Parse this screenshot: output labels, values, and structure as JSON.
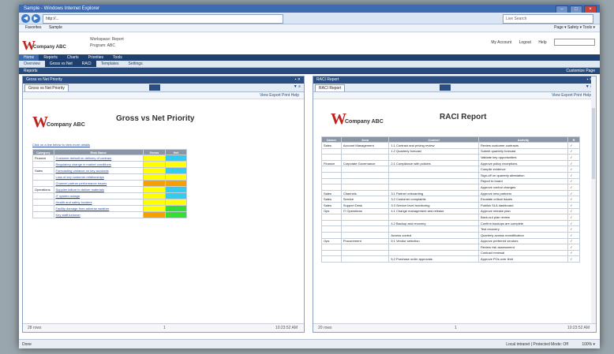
{
  "window": {
    "title": "Sample - Windows Internet Explorer",
    "controls": [
      "–",
      "□",
      "×"
    ]
  },
  "address": {
    "url": "http://...",
    "search_placeholder": "Live Search"
  },
  "ie_menu": {
    "left": [
      "Favorites",
      "Sample"
    ],
    "right": "Page ▾  Safety ▾  Tools ▾"
  },
  "app": {
    "company_letter": "W",
    "company_name": "Company ABC",
    "header_fields": [
      "Workspace:  Report",
      "Program:  ABC"
    ],
    "header_links": [
      "My Account",
      "Logout",
      "Help"
    ],
    "nav": [
      "Home",
      "Reports",
      "Charts",
      "Priorities",
      "Tools"
    ],
    "subnav": [
      "Overview",
      "Gross vs Net",
      "RACI",
      "Templates",
      "Settings"
    ],
    "toolbar": {
      "left": "Reports",
      "right": "Customize Page"
    }
  },
  "left_panel": {
    "header": "Gross vs Net Priority",
    "tab": "Gross vs Net Priority",
    "toolbar_links": "View  Export  Print  Help",
    "report_title": "Gross vs Net Priority",
    "note": "Click on a line below to view more details",
    "columns": [
      "Category",
      "Risk Name",
      "Gross",
      "Net"
    ],
    "rows": [
      {
        "cat": "Finance",
        "name": "Customer default on delivery of contract",
        "gross": "",
        "net": "",
        "gc": "#ffff00",
        "nc": "#33ccee"
      },
      {
        "cat": "",
        "name": "Regulatory change in market conditions",
        "gross": "",
        "net": "",
        "gc": "#ffff00",
        "nc": "#ffff00"
      },
      {
        "cat": "Sales",
        "name": "Forecasting variance on key accounts",
        "gross": "",
        "net": "",
        "gc": "#ffff00",
        "nc": "#33ccee"
      },
      {
        "cat": "",
        "name": "Loss of key customer relationships",
        "gross": "",
        "net": "",
        "gc": "#ffff00",
        "nc": "#ffff00"
      },
      {
        "cat": "",
        "name": "Channel partner performance issues",
        "gross": "",
        "net": "",
        "gc": "#f5a000",
        "nc": "#f5a000"
      },
      {
        "cat": "Operations",
        "name": "Supplier failure to deliver materials",
        "gross": "",
        "net": "",
        "gc": "#ffff00",
        "nc": "#33ccee"
      },
      {
        "cat": "",
        "name": "IT system outage",
        "gross": "",
        "net": "",
        "gc": "#ffff00",
        "nc": "#33ccee"
      },
      {
        "cat": "",
        "name": "Health and safety incident",
        "gross": "",
        "net": "",
        "gc": "#ffff00",
        "nc": "#ffff00"
      },
      {
        "cat": "",
        "name": "Facility damage from adverse weather",
        "gross": "",
        "net": "",
        "gc": "#ffff00",
        "nc": "#33dd33"
      },
      {
        "cat": "",
        "name": "Key staff turnover",
        "gross": "",
        "net": "",
        "gc": "#f5a000",
        "nc": "#33dd33"
      }
    ],
    "footer": {
      "left": "28 rows",
      "center": "1",
      "right": "10:23:52 AM"
    }
  },
  "right_panel": {
    "header": "RACI Report",
    "tab": "RACI Report",
    "toolbar_links": "View  Export  Print  Help",
    "report_title": "RACI Report",
    "columns": [
      "Owner",
      "Area",
      "Control",
      "Activity",
      "R"
    ],
    "rows": [
      [
        "Sales",
        "Account Management",
        "1.1 Contract and pricing review",
        "Review customer contracts",
        "✓"
      ],
      [
        "",
        "",
        "1.2 Quarterly forecast",
        "Submit quarterly forecast",
        "✓"
      ],
      [
        "",
        "",
        "",
        "Validate key opportunities",
        "✓"
      ],
      [
        "Finance",
        "Corporate Governance",
        "2.1 Compliance with policies",
        "Approve policy exceptions",
        "✓"
      ],
      [
        "",
        "",
        "",
        "Compile evidence",
        "✓"
      ],
      [
        "",
        "",
        "",
        "Sign-off on quarterly attestation",
        "✓"
      ],
      [
        "",
        "",
        "",
        "Report to board",
        "✓"
      ],
      [
        "",
        "",
        "",
        "Approve control changes",
        "✓"
      ],
      [
        "Sales",
        "Channels",
        "3.1 Partner onboarding",
        "Approve new partners",
        "✓"
      ],
      [
        "Sales",
        "Service",
        "3.2 Customer complaints",
        "Escalate critical issues",
        "✓"
      ],
      [
        "Sales",
        "Support Desk",
        "3.3 Service level monitoring",
        "Publish SLA dashboard",
        "✓"
      ],
      [
        "Ops",
        "IT Operations",
        "4.1 Change management and release",
        "Approve release plan",
        "✓"
      ],
      [
        "",
        "",
        "",
        "Back-out plan review",
        "✓"
      ],
      [
        "",
        "",
        "4.2 Backup and recovery",
        "Confirm backups are complete",
        "✓"
      ],
      [
        "",
        "",
        "",
        "Test recovery",
        "✓"
      ],
      [
        "",
        "",
        "Access control",
        "Quarterly access recertification",
        "✓"
      ],
      [
        "Ops",
        "Procurement",
        "5.1 Vendor selection",
        "Approve preferred vendors",
        "✓"
      ],
      [
        "",
        "",
        "",
        "Review risk assessment",
        "✓"
      ],
      [
        "",
        "",
        "",
        "Contract renewal",
        "✓"
      ],
      [
        "",
        "",
        "5.2 Purchase order approvals",
        "Approve POs over limit",
        "✓"
      ]
    ],
    "footer": {
      "left": "20 rows",
      "center": "1",
      "right": "10:23:52 AM"
    }
  },
  "statusbar": {
    "left": "Done",
    "right": "Local intranet | Protected Mode: Off",
    "zoom": "100% ▾"
  }
}
